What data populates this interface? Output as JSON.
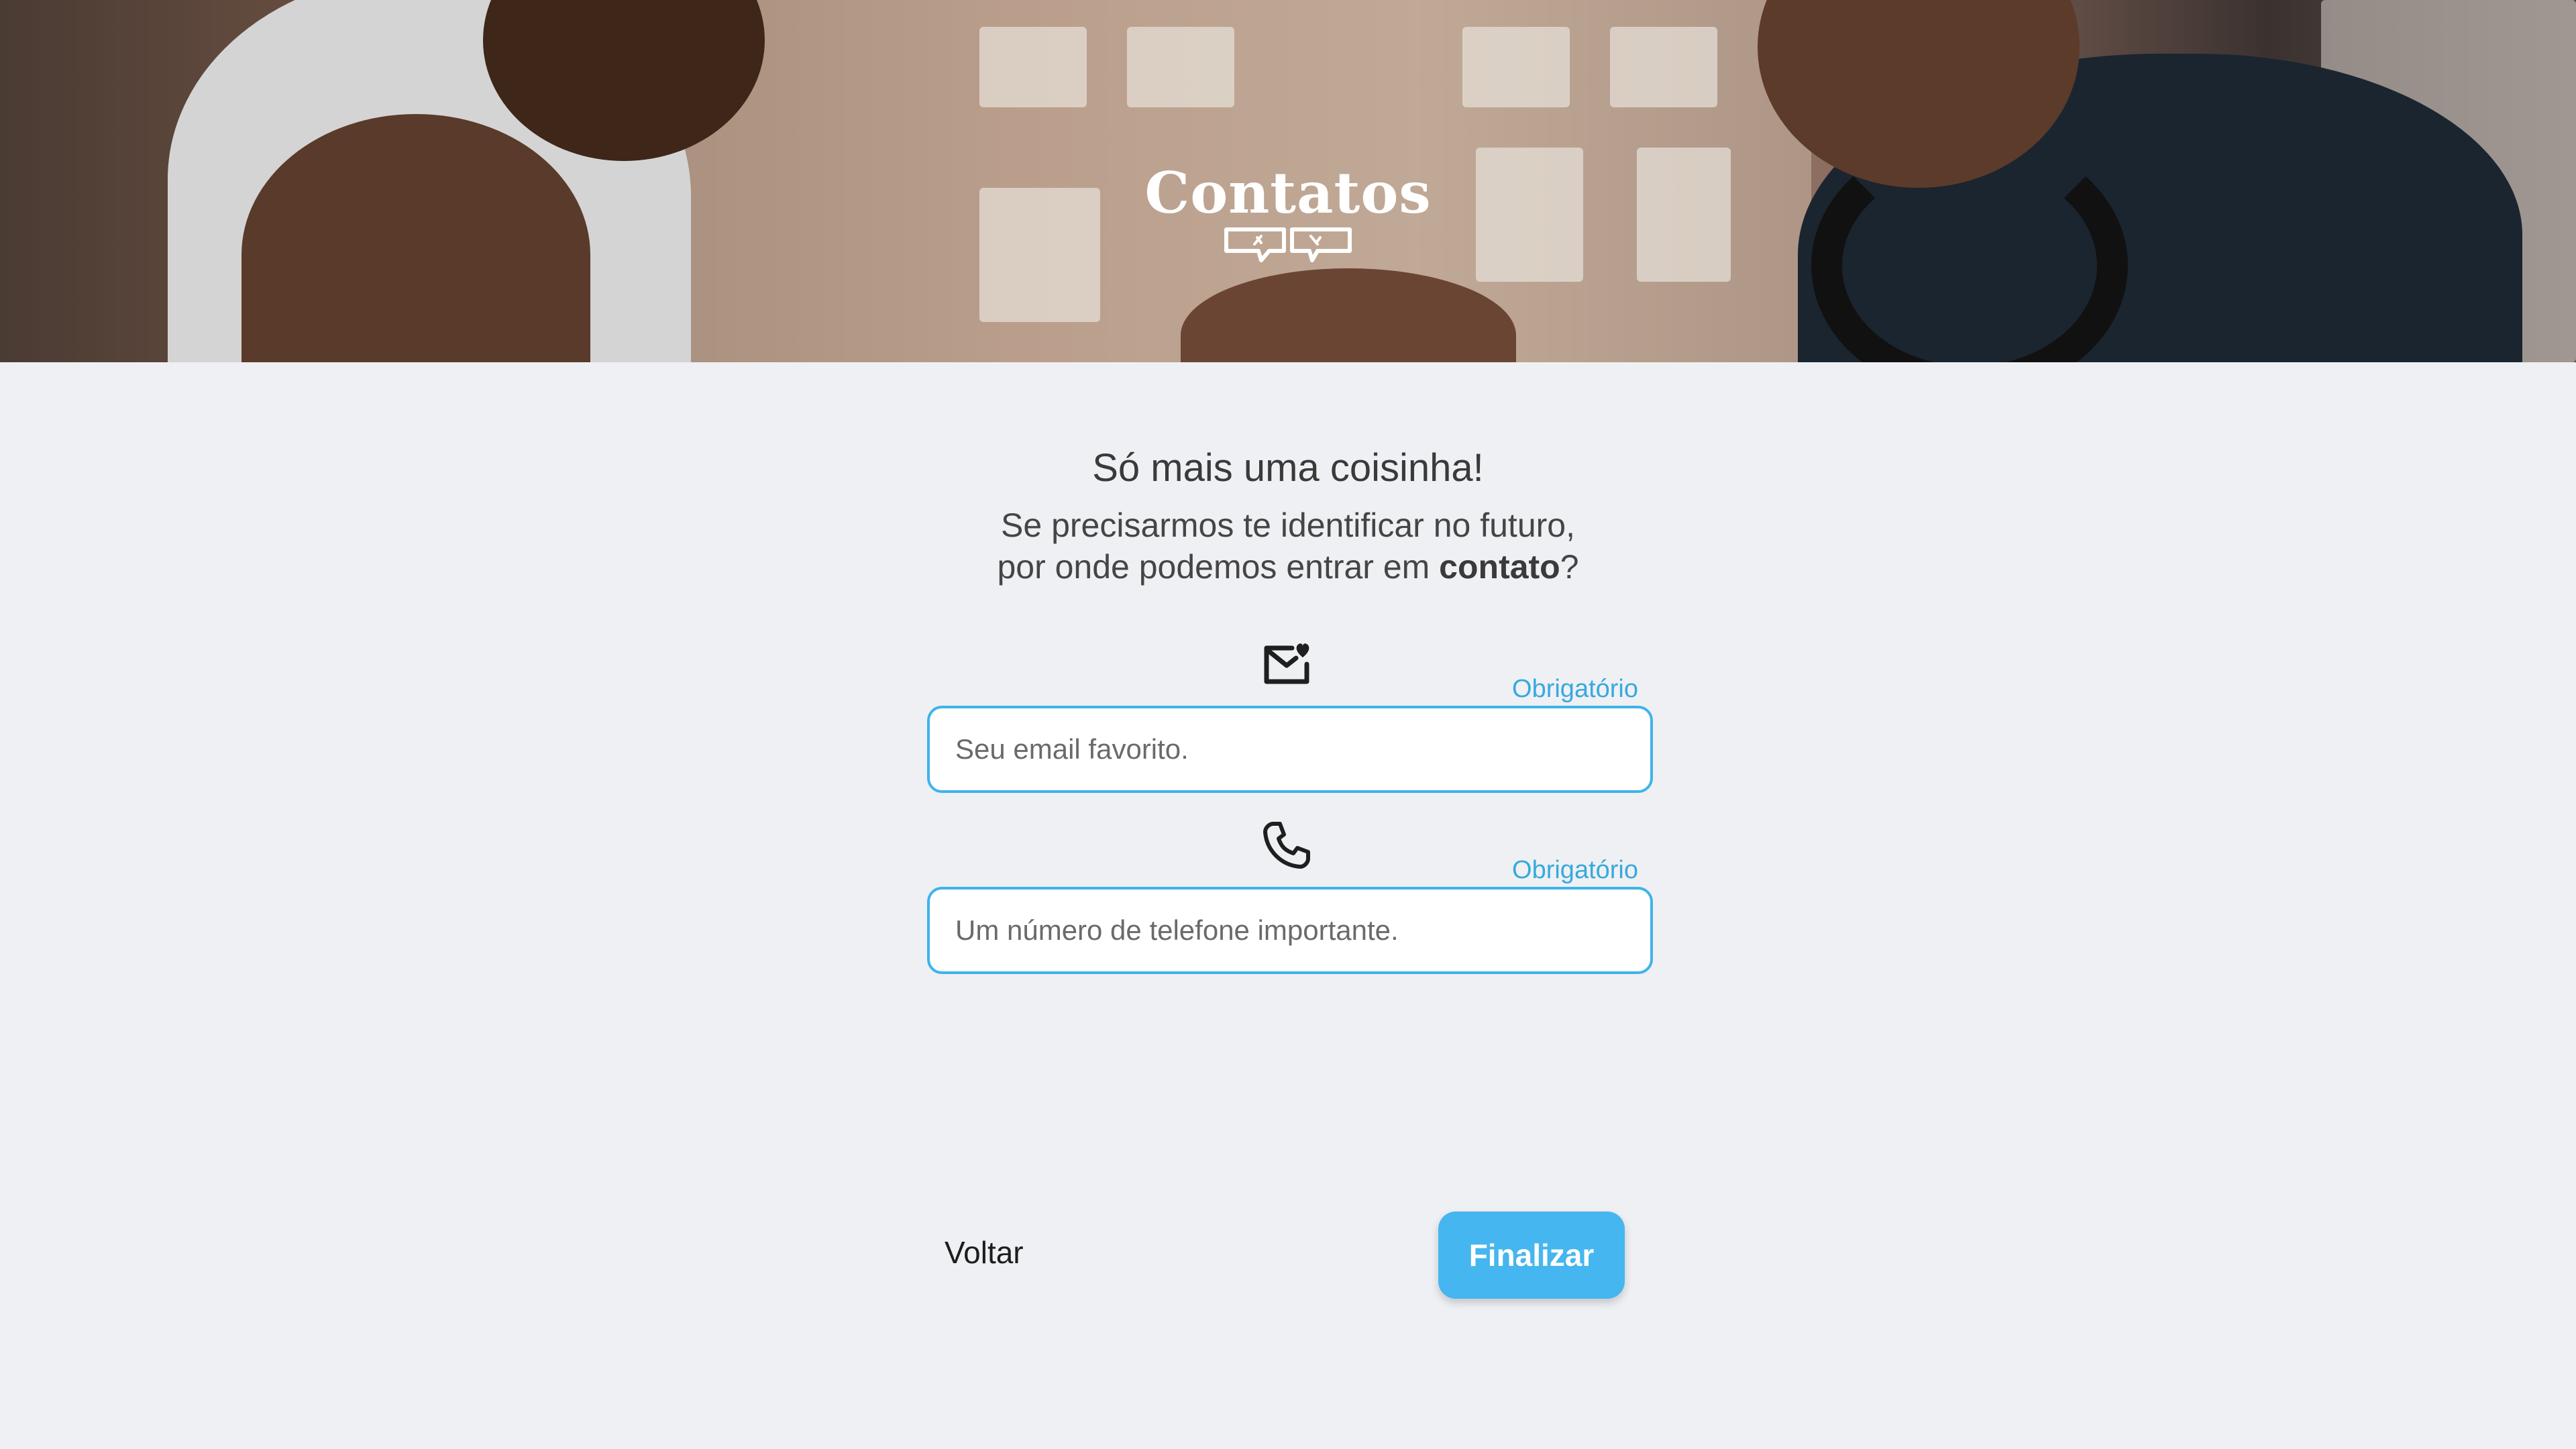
{
  "hero": {
    "title": "Contatos",
    "logo_icon": "chat-bubbles-icon"
  },
  "heading": "Só mais uma coisinha!",
  "subtitle": {
    "line1": "Se precisarmos te identificar no futuro,",
    "line2_prefix": "por onde podemos entrar em ",
    "line2_bold": "contato",
    "line2_suffix": "?"
  },
  "email": {
    "icon": "email-heart-icon",
    "required_label": "Obrigatório",
    "placeholder": "Seu email favorito.",
    "value": ""
  },
  "phone": {
    "icon": "phone-icon",
    "required_label": "Obrigatório",
    "placeholder": "Um número de telefone importante.",
    "value": ""
  },
  "actions": {
    "back_label": "Voltar",
    "finish_label": "Finalizar"
  },
  "colors": {
    "accent": "#45b6ef",
    "required_text": "#37a9de",
    "background": "#eff0f4"
  }
}
